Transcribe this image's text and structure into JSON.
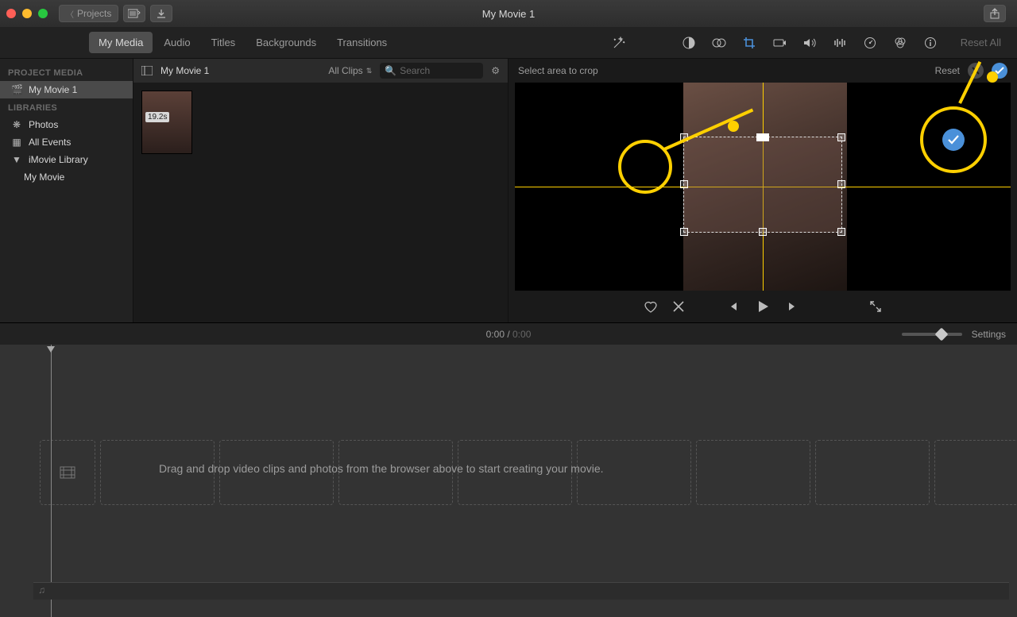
{
  "titlebar": {
    "back_label": "Projects",
    "window_title": "My Movie 1"
  },
  "tabs": {
    "items": [
      "My Media",
      "Audio",
      "Titles",
      "Backgrounds",
      "Transitions"
    ],
    "active_index": 0
  },
  "adjust_bar": {
    "reset_all_label": "Reset All"
  },
  "sidebar": {
    "section_project": "PROJECT MEDIA",
    "project_item": "My Movie 1",
    "section_libraries": "LIBRARIES",
    "lib_photos": "Photos",
    "lib_events": "All Events",
    "lib_imovie": "iMovie Library",
    "lib_imovie_child": "My Movie"
  },
  "browser": {
    "event_title": "My Movie 1",
    "filter_label": "All Clips",
    "search_placeholder": "Search",
    "clip_duration": "19.2s"
  },
  "crop": {
    "hint": "Select area to crop",
    "reset_label": "Reset"
  },
  "transport": {
    "current": "0:00",
    "sep": " / ",
    "total": "0:00"
  },
  "timeline": {
    "settings_label": "Settings",
    "drop_hint": "Drag and drop video clips and photos from the browser above to start creating your movie."
  }
}
